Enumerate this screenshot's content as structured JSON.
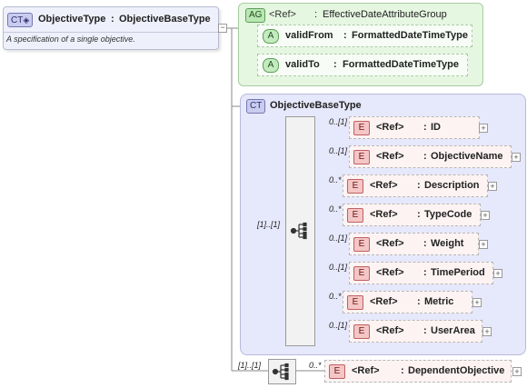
{
  "complex_type": {
    "badge": "CT",
    "name": "ObjectiveType",
    "separator": ":",
    "base": "ObjectiveBaseType",
    "description": "A specification of a single objective."
  },
  "attribute_group": {
    "badge": "AG",
    "ref": "<Ref>",
    "separator": ":",
    "name": "EffectiveDateAttributeGroup",
    "attributes": [
      {
        "badge": "A",
        "name": "validFrom",
        "separator": ":",
        "type": "FormattedDateTimeType"
      },
      {
        "badge": "A",
        "name": "validTo",
        "separator": ":",
        "type": "FormattedDateTimeType"
      }
    ]
  },
  "base_type": {
    "badge": "CT",
    "name": "ObjectiveBaseType",
    "sequence_cardinality": "[1]..[1]",
    "elements": [
      {
        "badge": "E",
        "ref": "<Ref>",
        "separator": ":",
        "name": "ID",
        "cardinality": "0..[1]"
      },
      {
        "badge": "E",
        "ref": "<Ref>",
        "separator": ":",
        "name": "ObjectiveName",
        "cardinality": "0..[1]"
      },
      {
        "badge": "E",
        "ref": "<Ref>",
        "separator": ":",
        "name": "Description",
        "cardinality": "0..*"
      },
      {
        "badge": "E",
        "ref": "<Ref>",
        "separator": ":",
        "name": "TypeCode",
        "cardinality": "0..*"
      },
      {
        "badge": "E",
        "ref": "<Ref>",
        "separator": ":",
        "name": "Weight",
        "cardinality": "0..[1]"
      },
      {
        "badge": "E",
        "ref": "<Ref>",
        "separator": ":",
        "name": "TimePeriod",
        "cardinality": "0..[1]"
      },
      {
        "badge": "E",
        "ref": "<Ref>",
        "separator": ":",
        "name": "Metric",
        "cardinality": "0..*"
      },
      {
        "badge": "E",
        "ref": "<Ref>",
        "separator": ":",
        "name": "UserArea",
        "cardinality": "0..[1]"
      }
    ]
  },
  "dependent": {
    "sequence_cardinality": "[1]..[1]",
    "element": {
      "badge": "E",
      "ref": "<Ref>",
      "separator": ":",
      "name": "DependentObjective",
      "cardinality": "0..*"
    }
  },
  "colors": {
    "ct_fill": "#eef0fb",
    "ag_fill": "#e5f6e1",
    "base_fill": "#e6e8fb",
    "element_badge": "#f4c6c6",
    "attribute_badge": "#c4ebbf"
  }
}
